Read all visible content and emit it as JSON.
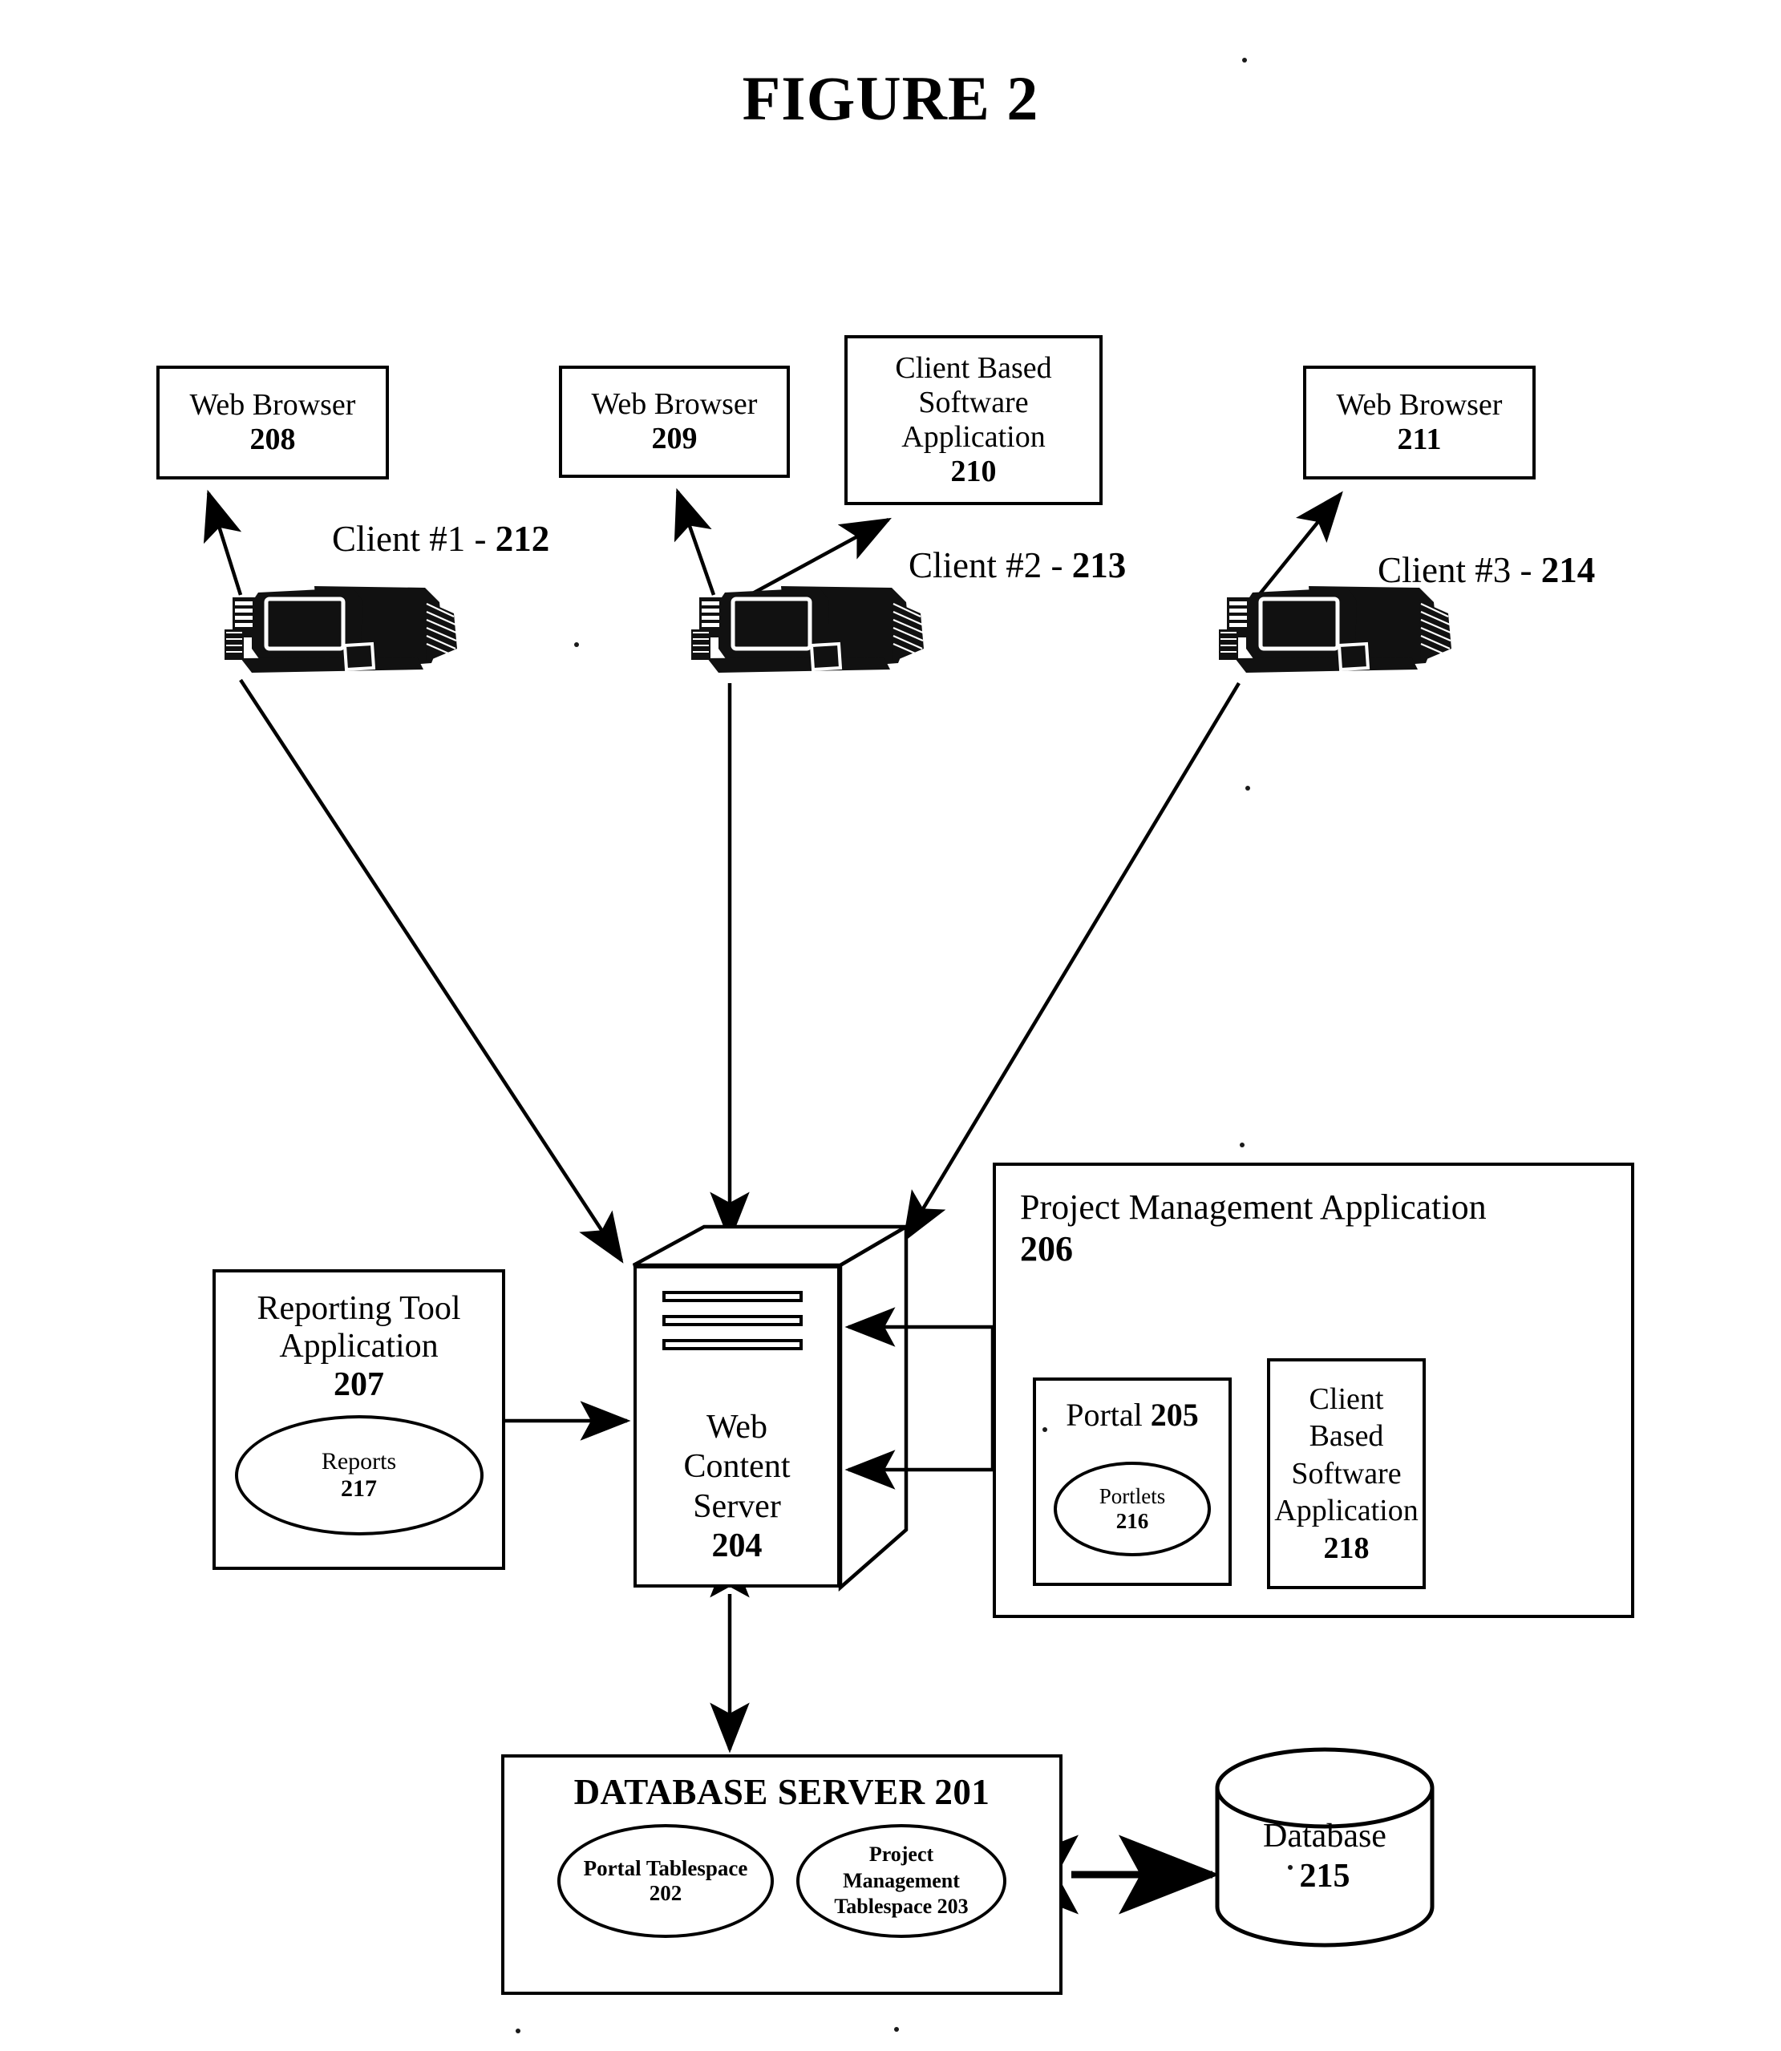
{
  "figure": {
    "title": "FIGURE 2"
  },
  "top_boxes": [
    {
      "id": "208",
      "label": "Web Browser",
      "number": "208"
    },
    {
      "id": "209",
      "label": "Web Browser",
      "number": "209"
    },
    {
      "id": "210",
      "line1": "Client Based",
      "line2": "Software",
      "line3": "Application",
      "number": "210"
    },
    {
      "id": "211",
      "label": "Web Browser",
      "number": "211"
    }
  ],
  "client_labels": [
    {
      "text": "Client #1 - ",
      "number": "212"
    },
    {
      "text": "Client #2 - ",
      "number": "213"
    },
    {
      "text": "Client #3 - ",
      "number": "214"
    }
  ],
  "reporting_tool": {
    "line1": "Reporting Tool",
    "line2": "Application",
    "number": "207",
    "reports": {
      "label": "Reports",
      "number": "217"
    }
  },
  "web_content_server": {
    "line1": "Web",
    "line2": "Content",
    "line3": "Server",
    "number": "204"
  },
  "project_management": {
    "title": "Project Management Application",
    "number": "206",
    "portal": {
      "label": "Portal ",
      "number": "205",
      "portlets": {
        "label": "Portlets",
        "number": "216"
      }
    },
    "client_based_app": {
      "line1": "Client",
      "line2": "Based",
      "line3": "Software",
      "line4": "Application",
      "number": "218"
    }
  },
  "database_server": {
    "title": "DATABASE SERVER  201",
    "portal_tablespace": {
      "label": "Portal Tablespace",
      "number": "202"
    },
    "project_management_tablespace": {
      "line1": "Project",
      "line2": "Management",
      "line3": "Tablespace  203"
    }
  },
  "database": {
    "label": "Database",
    "number": "215"
  },
  "colors": {
    "ink": "#000000",
    "paper": "#ffffff"
  },
  "icons": {
    "workstation": "desktop-computer-icon",
    "database": "database-cylinder-icon",
    "server": "server-tower-icon"
  }
}
